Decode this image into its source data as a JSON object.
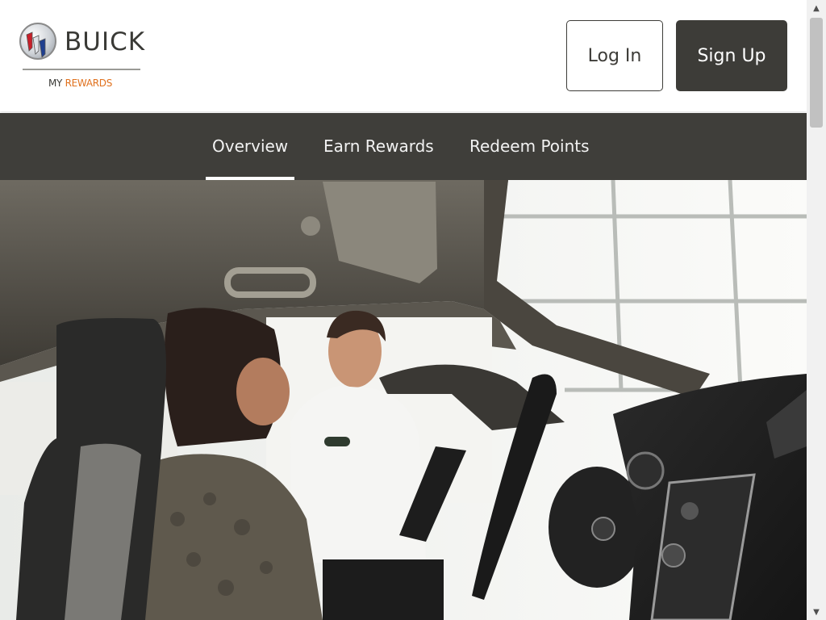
{
  "brand": {
    "name": "BUICK",
    "program_prefix": "MY",
    "program_accent": "REWARDS",
    "accent_color": "#e0711e"
  },
  "header": {
    "login_label": "Log In",
    "signup_label": "Sign Up"
  },
  "nav": {
    "items": [
      {
        "label": "Overview",
        "active": true
      },
      {
        "label": "Earn Rewards",
        "active": false
      },
      {
        "label": "Redeem Points",
        "active": false
      }
    ]
  },
  "colors": {
    "dark": "#3f3e3a",
    "button_dark": "#3d3c38"
  },
  "icons": {
    "logo": "buick-tri-shield-icon",
    "scroll_up": "arrow-up-icon",
    "scroll_down": "arrow-down-icon"
  }
}
